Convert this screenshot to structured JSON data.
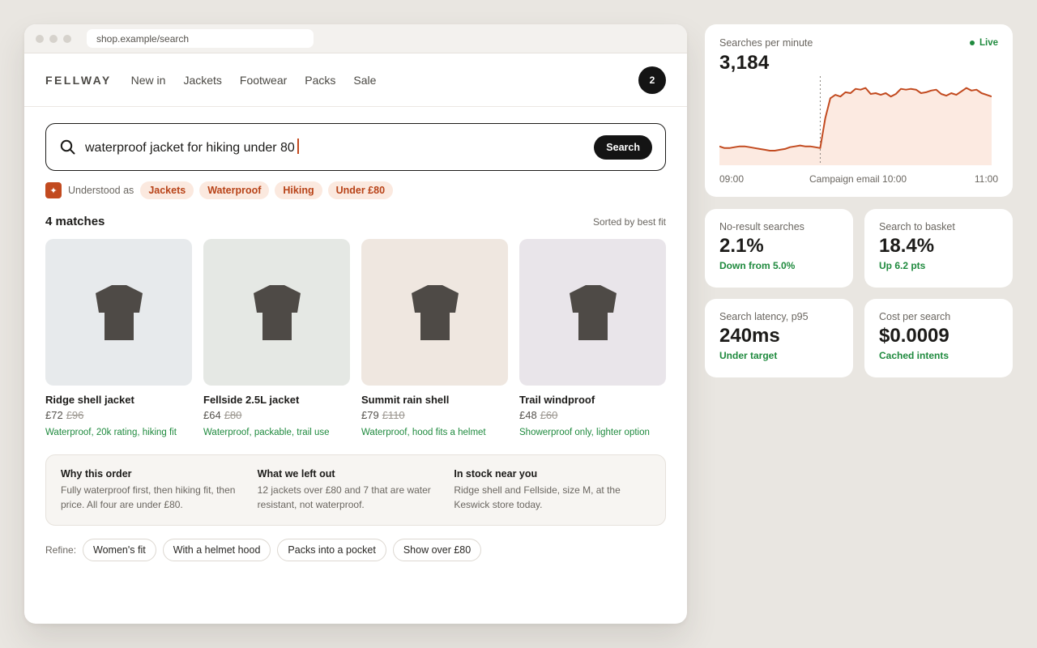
{
  "browser": {
    "url": "shop.example/search"
  },
  "nav": {
    "logo": "FELLWAY",
    "links": [
      "New in",
      "Jackets",
      "Footwear",
      "Packs",
      "Sale"
    ],
    "cart_count": "2"
  },
  "search": {
    "query": "waterproof jacket for hiking under 80",
    "button": "Search"
  },
  "understood": {
    "label": "Understood as",
    "chips": [
      "Jackets",
      "Waterproof",
      "Hiking",
      "Under £80"
    ]
  },
  "results": {
    "count": "4 matches",
    "sort": "Sorted by best fit",
    "products": [
      {
        "name": "Ridge shell jacket",
        "price": "£72",
        "was": "£96",
        "reason": "Waterproof, 20k rating, hiking fit",
        "bg": "#e7eaec"
      },
      {
        "name": "Fellside 2.5L jacket",
        "price": "£64",
        "was": "£80",
        "reason": "Waterproof, packable, trail use",
        "bg": "#e5e8e4"
      },
      {
        "name": "Summit rain shell",
        "price": "£79",
        "was": "£110",
        "reason": "Waterproof, hood fits a helmet",
        "bg": "#efe7e0"
      },
      {
        "name": "Trail windproof",
        "price": "£48",
        "was": "£60",
        "reason": "Showerproof only, lighter option",
        "bg": "#e9e5ea"
      }
    ]
  },
  "explain": [
    {
      "title": "Why this order",
      "body": "Fully waterproof first, then hiking fit, then price. All four are under £80."
    },
    {
      "title": "What we left out",
      "body": "12 jackets over £80 and 7 that are water resistant, not waterproof."
    },
    {
      "title": "In stock near you",
      "body": "Ridge shell and Fellside, size M, at the Keswick store today."
    }
  ],
  "refine": {
    "label": "Refine:",
    "options": [
      "Women's fit",
      "With a helmet hood",
      "Packs into a pocket",
      "Show over £80"
    ]
  },
  "dashboard": {
    "spm": {
      "label": "Searches per minute",
      "value": "3,184",
      "live": "Live",
      "x_labels": [
        "09:00",
        "Campaign email 10:00",
        "11:00"
      ]
    },
    "metrics": [
      {
        "label": "No-result searches",
        "value": "2.1%",
        "sub": "Down from 5.0%"
      },
      {
        "label": "Search to basket",
        "value": "18.4%",
        "sub": "Up 6.2 pts"
      },
      {
        "label": "Search latency, p95",
        "value": "240ms",
        "sub": "Under target"
      },
      {
        "label": "Cost per search",
        "value": "$0.0009",
        "sub": "Cached intents"
      }
    ]
  },
  "chart_data": {
    "type": "area",
    "title": "Searches per minute",
    "x_labels": [
      "09:00",
      "Campaign email 10:00",
      "11:00"
    ],
    "marker": "Campaign email 10:00",
    "color": "#c24a1f",
    "values": [
      0.22,
      0.2,
      0.2,
      0.21,
      0.22,
      0.22,
      0.21,
      0.2,
      0.19,
      0.18,
      0.17,
      0.17,
      0.18,
      0.19,
      0.21,
      0.22,
      0.23,
      0.22,
      0.22,
      0.21,
      0.2,
      0.55,
      0.78,
      0.82,
      0.8,
      0.85,
      0.84,
      0.89,
      0.88,
      0.9,
      0.83,
      0.84,
      0.82,
      0.84,
      0.8,
      0.83,
      0.89,
      0.88,
      0.89,
      0.88,
      0.84,
      0.85,
      0.87,
      0.88,
      0.83,
      0.81,
      0.84,
      0.82,
      0.86,
      0.9,
      0.87,
      0.88,
      0.84,
      0.82,
      0.8
    ]
  }
}
